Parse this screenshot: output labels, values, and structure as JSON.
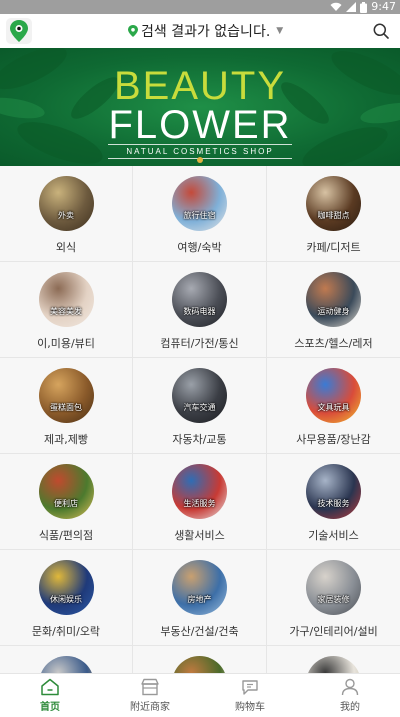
{
  "status_bar": {
    "time": "9:47"
  },
  "header": {
    "location_text": "검색 결과가 없습니다.",
    "icons": {
      "logo": "map-pin-logo-icon",
      "location": "location-pin-icon",
      "dropdown": "caret-down-icon",
      "search": "search-icon"
    }
  },
  "banner": {
    "title_line1": "BEAUTY",
    "title_line2": "FLOWER",
    "subtitle": "NATUAL COSMETICS SHOP",
    "colors": {
      "background": "#0f6a33",
      "title_accent": "#c8dc3c"
    }
  },
  "categories": [
    {
      "label": "외식",
      "badge": "外卖",
      "colors": [
        "#6d5a3e",
        "#c9b27c",
        "#3d2f1e"
      ]
    },
    {
      "label": "여행/숙박",
      "badge": "旅行住宿",
      "colors": [
        "#7fb0d8",
        "#c44a3a",
        "#e6e6e6"
      ]
    },
    {
      "label": "카페/디저트",
      "badge": "咖啡甜点",
      "colors": [
        "#5a3a22",
        "#d7c2a3",
        "#2b1c10"
      ]
    },
    {
      "label": "이,미용/뷰티",
      "badge": "美容美发",
      "colors": [
        "#e3d2c4",
        "#8c6b55",
        "#f2e9e1"
      ]
    },
    {
      "label": "컴퓨터/가전/통신",
      "badge": "数码电器",
      "colors": [
        "#4a4d55",
        "#a7aab2",
        "#1f2126"
      ]
    },
    {
      "label": "스포츠/헬스/레저",
      "badge": "运动健身",
      "colors": [
        "#3a4a5a",
        "#c07a50",
        "#e8e0d5"
      ]
    },
    {
      "label": "제과,제빵",
      "badge": "蛋糕面包",
      "colors": [
        "#8a5a2a",
        "#d6a45e",
        "#4a2e14"
      ]
    },
    {
      "label": "자동차/교통",
      "badge": "汽车交通",
      "colors": [
        "#3a3d44",
        "#9aa0a8",
        "#1c1d21"
      ]
    },
    {
      "label": "사무용품/장난감",
      "badge": "文具玩具",
      "colors": [
        "#d94c3a",
        "#3a7bd5",
        "#f2c12e"
      ]
    },
    {
      "label": "식품/편의점",
      "badge": "便利店",
      "colors": [
        "#4c7a2e",
        "#c04a2e",
        "#e2c15a"
      ]
    },
    {
      "label": "생활서비스",
      "badge": "生活服务",
      "colors": [
        "#c83a34",
        "#2f6db5",
        "#e9e9e9"
      ]
    },
    {
      "label": "기술서비스",
      "badge": "技术服务",
      "colors": [
        "#2a3550",
        "#a7b4c8",
        "#c43a3a"
      ]
    },
    {
      "label": "문화/취미/오락",
      "badge": "休闲娱乐",
      "colors": [
        "#1f3a7a",
        "#e0b83a",
        "#2d5aa6"
      ]
    },
    {
      "label": "부동산/건설/건축",
      "badge": "房地产",
      "colors": [
        "#3d6fa8",
        "#c9a070",
        "#9ec0e0"
      ]
    },
    {
      "label": "가구/인테리어/설비",
      "badge": "家居装修",
      "colors": [
        "#8a8f96",
        "#d7d2cb",
        "#4a4e54"
      ]
    },
    {
      "label": "",
      "badge": "",
      "colors": [
        "#3a5a8a",
        "#c8c8c8",
        "#e0b060"
      ]
    },
    {
      "label": "",
      "badge": "",
      "colors": [
        "#4a6a2a",
        "#c07a40",
        "#e8d8c0"
      ]
    },
    {
      "label": "",
      "badge": "",
      "colors": [
        "#e8e4dc",
        "#3a3a3a",
        "#b0a890"
      ]
    }
  ],
  "tabbar": {
    "items": [
      {
        "label": "首页",
        "icon": "home-icon",
        "active": true
      },
      {
        "label": "附近商家",
        "icon": "store-icon",
        "active": false
      },
      {
        "label": "购物车",
        "icon": "cart-chat-icon",
        "active": false
      },
      {
        "label": "我的",
        "icon": "user-icon",
        "active": false
      }
    ],
    "colors": {
      "active": "#2e8b3a",
      "inactive": "#999999"
    }
  }
}
